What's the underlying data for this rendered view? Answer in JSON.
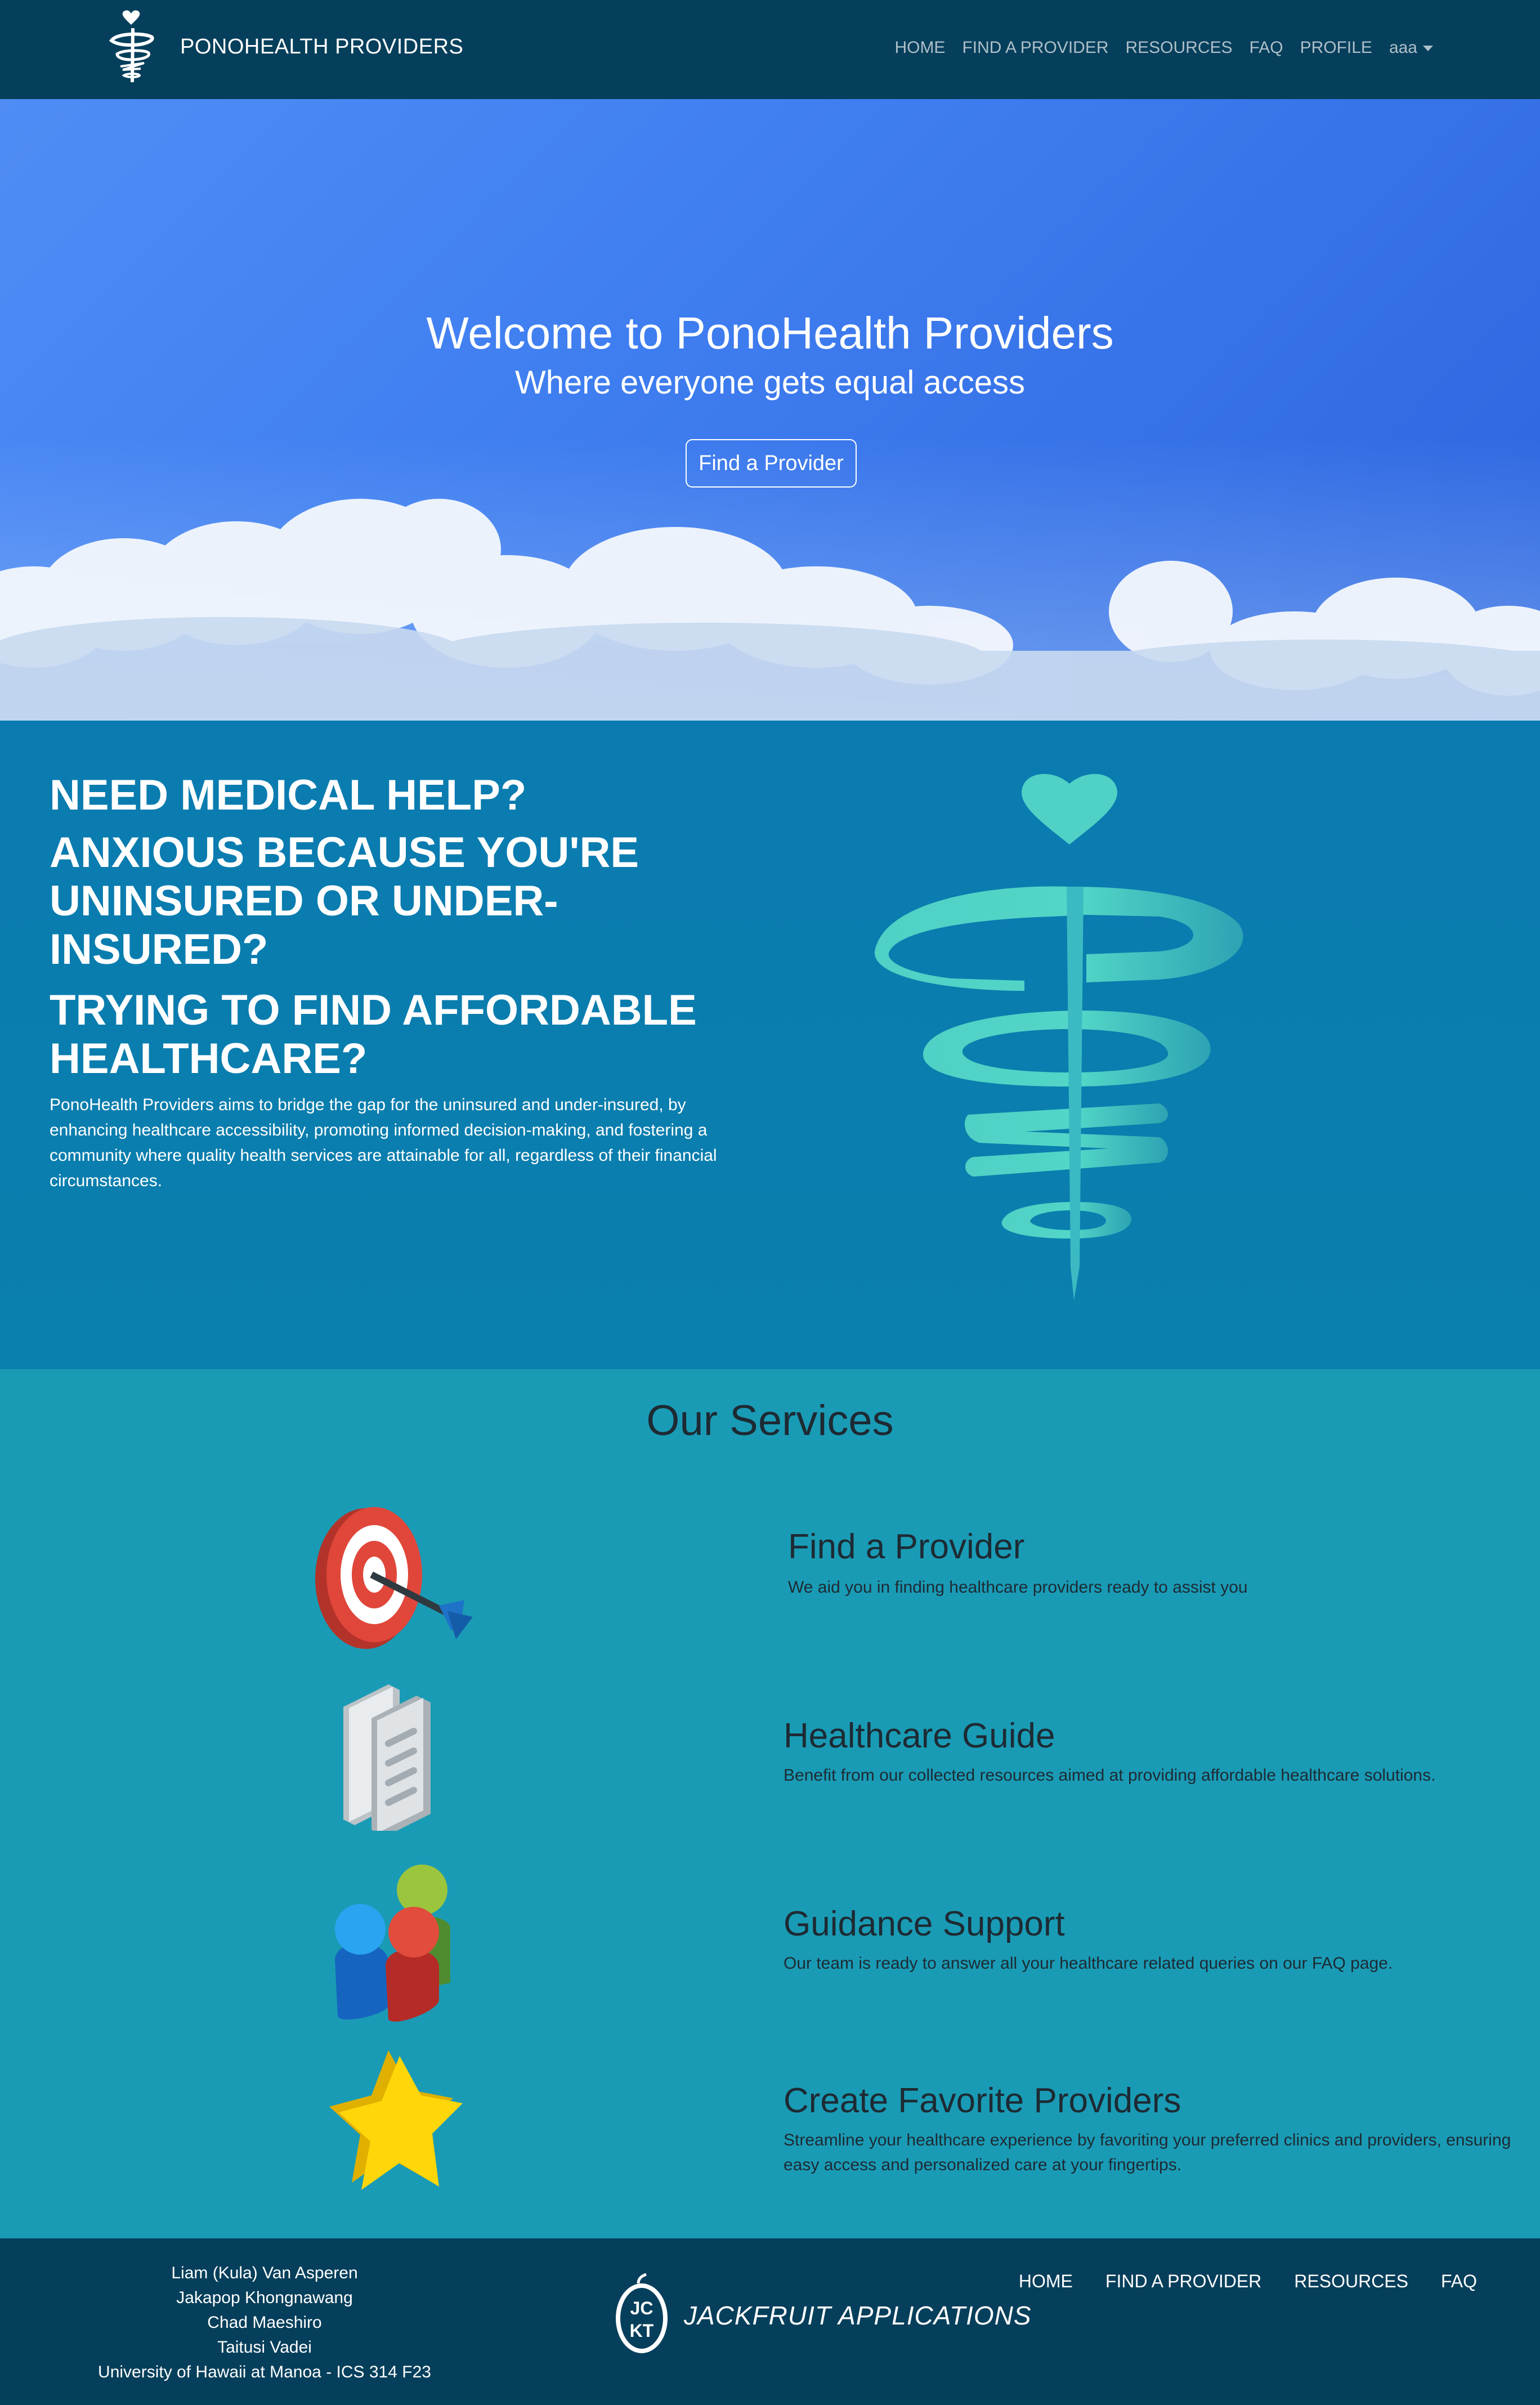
{
  "navbar": {
    "brand": "PONOHEALTH PROVIDERS",
    "links": [
      "HOME",
      "FIND A PROVIDER",
      "RESOURCES",
      "FAQ",
      "PROFILE"
    ],
    "user_menu": "aaa"
  },
  "hero": {
    "title": "Welcome to PonoHealth Providers",
    "subtitle": "Where everyone gets equal access",
    "button": "Find a Provider"
  },
  "medical": {
    "heading1": "NEED MEDICAL HELP?",
    "heading2": "ANXIOUS BECAUSE YOU'RE UNINSURED OR UNDER-INSURED?",
    "heading3": "TRYING TO FIND AFFORDABLE HEALTHCARE?",
    "description": "PonoHealth Providers aims to bridge the gap for the uninsured and under-insured, by enhancing healthcare accessibility, promoting informed decision-making, and fostering a community where quality health services are attainable for all, regardless of their financial circumstances."
  },
  "services": {
    "title": "Our Services",
    "items": [
      {
        "icon": "target-icon",
        "title": "Find a Provider",
        "description": "We aid you in finding healthcare providers ready to assist you"
      },
      {
        "icon": "document-icon",
        "title": "Healthcare Guide",
        "description": "Benefit from our collected resources aimed at providing affordable healthcare solutions."
      },
      {
        "icon": "people-icon",
        "title": "Guidance Support",
        "description": "Our team is ready to answer all your healthcare related queries on our FAQ page."
      },
      {
        "icon": "star-icon",
        "title": "Create Favorite Providers",
        "description": "Streamline your healthcare experience by favoriting your preferred clinics and providers, ensuring easy access and personalized care at your fingertips."
      }
    ]
  },
  "footer": {
    "names": [
      "Liam (Kula) Van Asperen",
      "Jakapop Khongnawang",
      "Chad Maeshiro",
      "Taitusi Vadei",
      "University of Hawaii at Manoa - ICS 314 F23"
    ],
    "brand": "JACKFRUIT APPLICATIONS",
    "logo_letters": "JCKT",
    "links": [
      "HOME",
      "FIND A PROVIDER",
      "RESOURCES",
      "FAQ"
    ]
  },
  "colors": {
    "navbar": "#063f5b",
    "medical_bg": "#0a7bb0",
    "services_bg": "#1a9bb5",
    "logo_teal": "#4fd1c5",
    "text_dark": "#1d2a33"
  }
}
